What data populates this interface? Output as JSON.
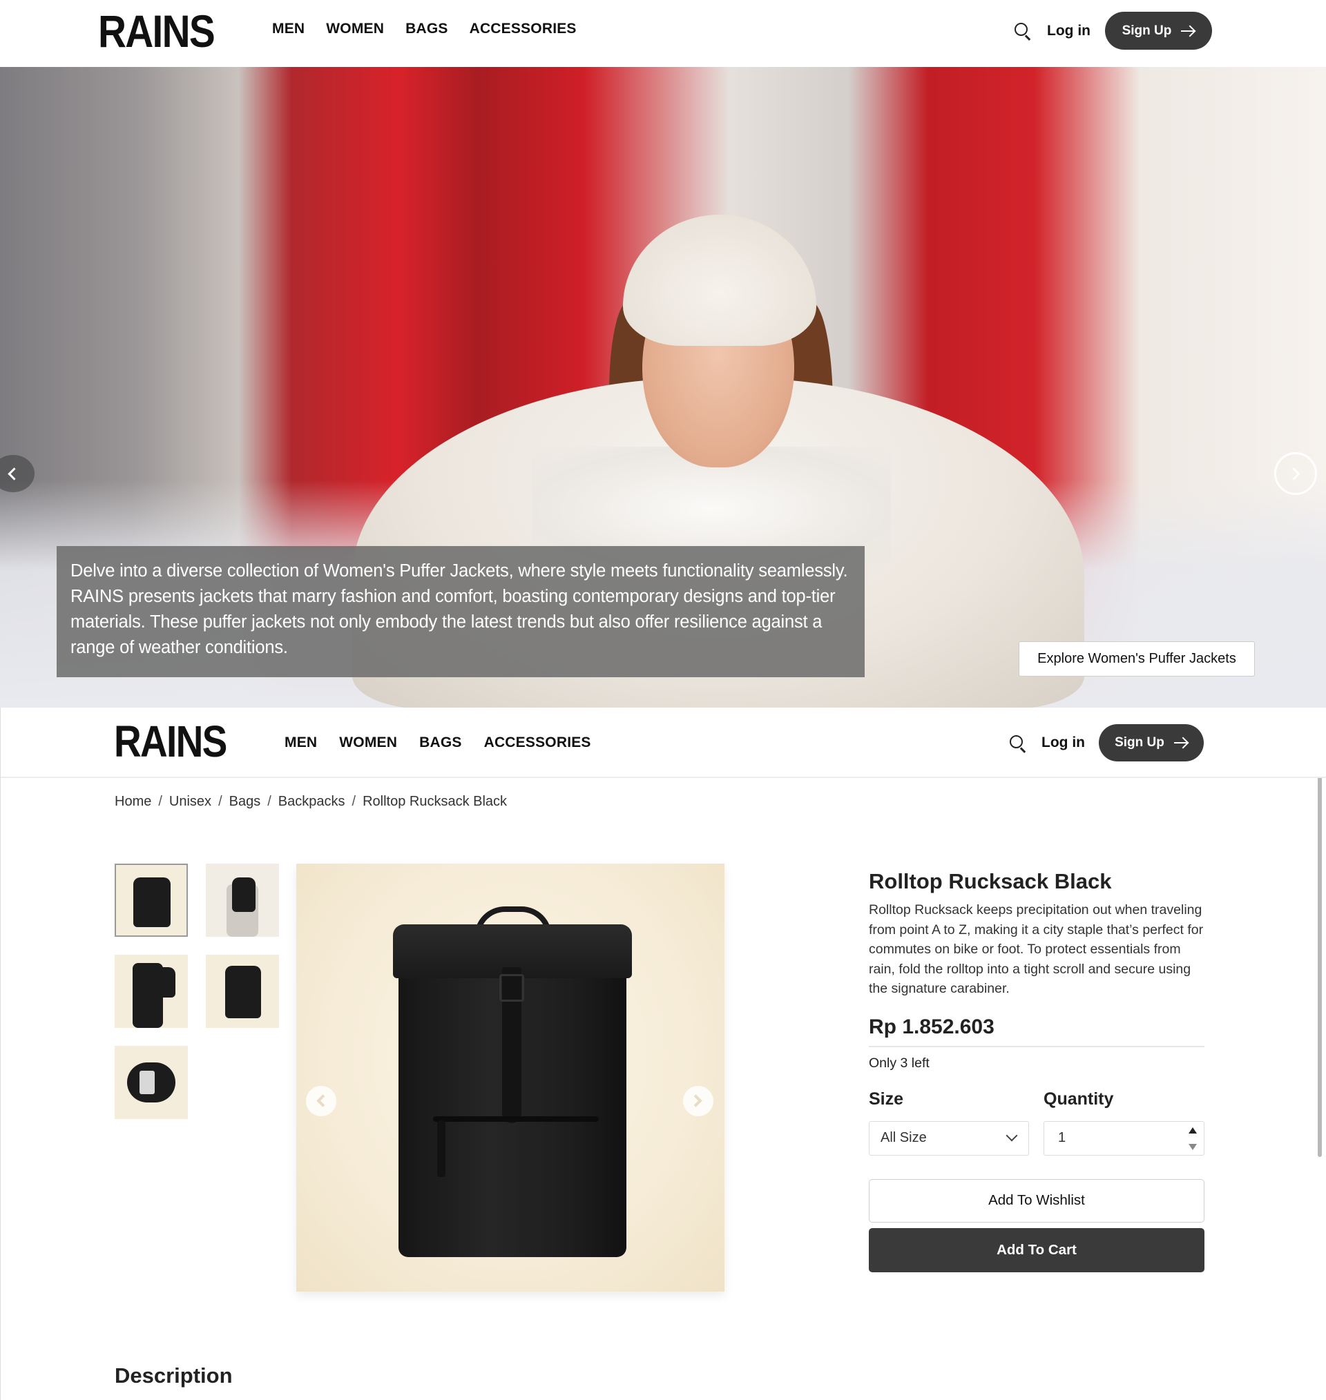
{
  "brand": {
    "logo": "RAINS"
  },
  "nav": {
    "items": [
      "MEN",
      "WOMEN",
      "BAGS",
      "ACCESSORIES"
    ]
  },
  "header_actions": {
    "login": "Log in",
    "signup": "Sign Up"
  },
  "hero": {
    "caption": "Delve into a diverse collection of Women's Puffer Jackets, where style meets functionality seamlessly. RAINS presents jackets that marry fashion and comfort, boasting contemporary designs and top-tier materials. These puffer jackets not only embody the latest trends but also offer resilience against a range of weather conditions.",
    "cta": "Explore Women's Puffer Jackets",
    "image_name": "woman-in-white-puffer-jacket-by-red-phone-booth"
  },
  "breadcrumb": [
    "Home",
    "Unisex",
    "Bags",
    "Backpacks",
    "Rolltop Rucksack Black"
  ],
  "breadcrumb_separator": "/",
  "product": {
    "title": "Rolltop Rucksack Black",
    "description": "Rolltop Rucksack keeps precipitation out when traveling from point A to Z, making it a city staple that’s perfect for commutes on bike or foot. To protect essentials from rain, fold the rolltop into a tight scroll and secure using the signature carabiner.",
    "price": "Rp 1.852.603",
    "stock": "Only 3 left",
    "size_label": "Size",
    "quantity_label": "Quantity",
    "size_selected": "All Size",
    "quantity_value": "1",
    "wishlist_button": "Add To Wishlist",
    "cart_button": "Add To Cart",
    "thumbnails": [
      "backpack-front",
      "model-wearing-backpack-back",
      "model-wearing-backpack-side",
      "backpack-back",
      "backpack-open-interior"
    ],
    "selected_thumbnail": 0
  },
  "description_heading": "Description",
  "colors": {
    "button_dark": "#3a3a3a",
    "product_bg": "#f6ecd7",
    "caption_bg": "#6e6e6e"
  }
}
